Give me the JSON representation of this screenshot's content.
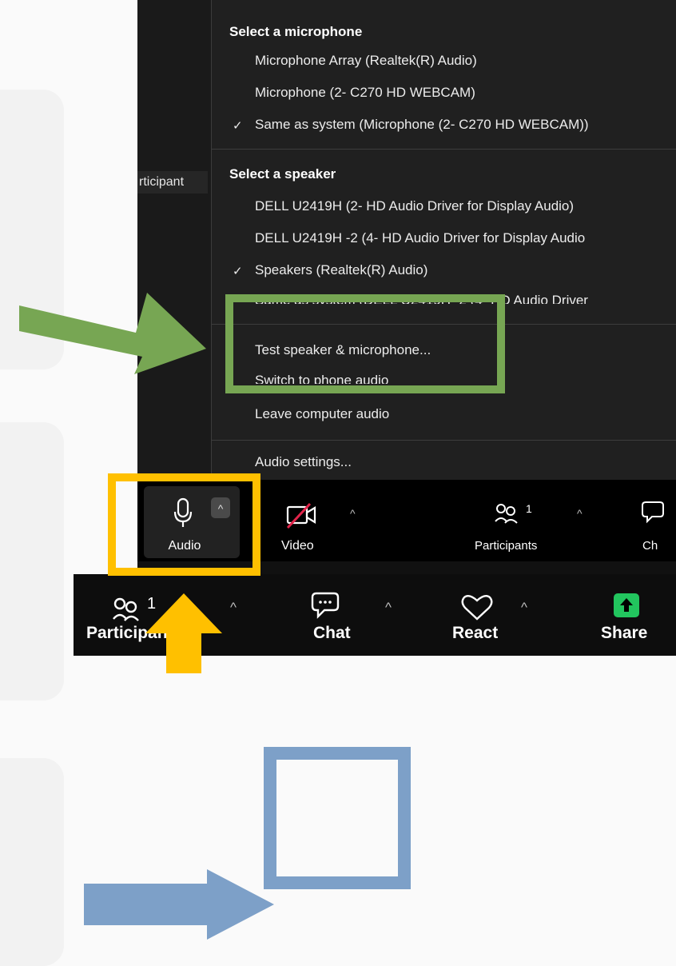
{
  "cards": {
    "count": 3
  },
  "sidebar": {
    "participant_tab": "rticipant"
  },
  "audio_menu": {
    "mic_header": "Select a microphone",
    "mic_items": [
      {
        "label": "Microphone Array (Realtek(R) Audio)",
        "checked": false
      },
      {
        "label": "Microphone (2- C270 HD WEBCAM)",
        "checked": false
      },
      {
        "label": "Same as system (Microphone (2- C270 HD WEBCAM))",
        "checked": true
      }
    ],
    "speaker_header": "Select a speaker",
    "speaker_items": [
      {
        "label": "DELL U2419H (2- HD Audio Driver for Display Audio)",
        "checked": false
      },
      {
        "label": "DELL U2419H -2 (4- HD Audio Driver for Display Audio",
        "checked": false
      },
      {
        "label": "Speakers (Realtek(R) Audio)",
        "checked": true
      },
      {
        "label": "Same as system (DELL U2419H -2 (4- HD Audio Driver",
        "checked": false
      }
    ],
    "check_mark": "✓",
    "test_speaker": "Test speaker & microphone...",
    "switch_phone": "Switch to phone audio",
    "leave_audio": "Leave computer audio",
    "audio_settings": "Audio settings..."
  },
  "toolbar_top": {
    "audio": "Audio",
    "video": "Video",
    "participants": "Participants",
    "participants_count": "1",
    "chat_partial": "Ch"
  },
  "toolbar_bottom": {
    "participants": "Participants",
    "participants_count": "1",
    "chat": "Chat",
    "react": "React",
    "share": "Share"
  },
  "highlight_colors": {
    "green": "#77a653",
    "yellow": "#ffc000",
    "blue": "#7da0c8"
  }
}
